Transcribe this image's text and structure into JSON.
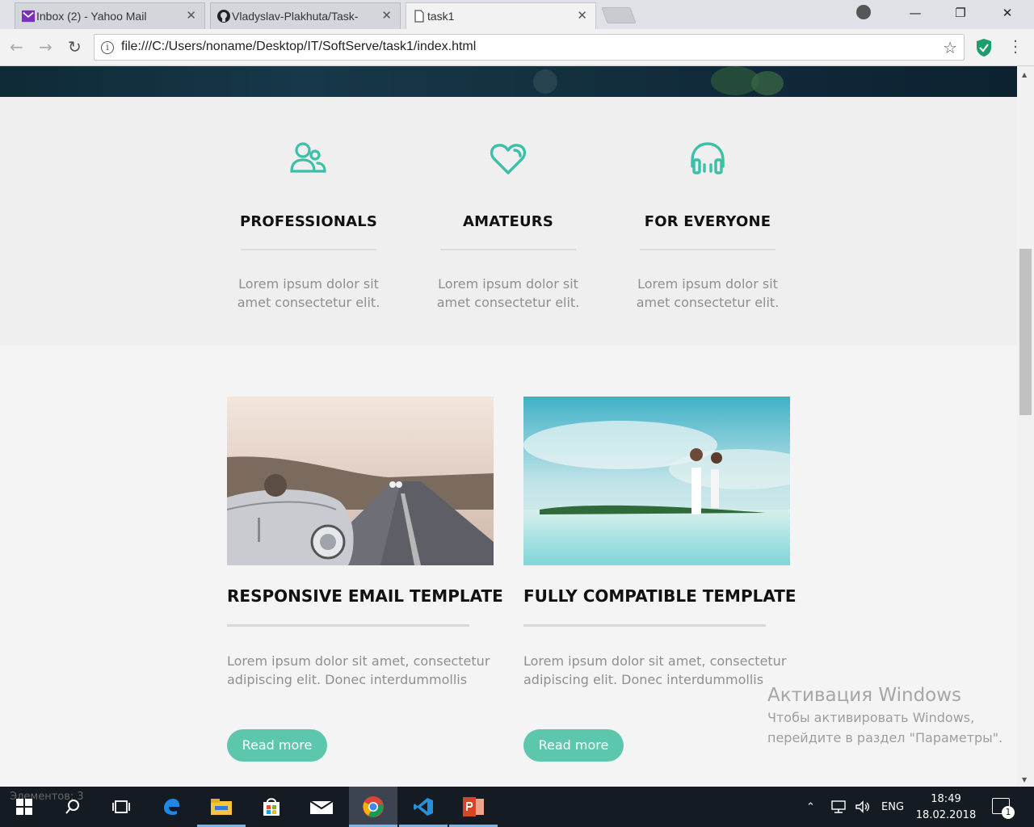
{
  "browser": {
    "tabs": [
      {
        "label": "Inbox (2) - Yahoo Mail",
        "icon": "yahoo-mail-icon"
      },
      {
        "label": "Vladyslav-Plakhuta/Task-",
        "icon": "github-icon"
      },
      {
        "label": "task1",
        "icon": "document-icon"
      }
    ],
    "url": "file:///C:/Users/noname/Desktop/IT/SoftServe/task1/index.html",
    "accent": "#5dc7ae"
  },
  "features": [
    {
      "icon": "users-icon",
      "title": "PROFESSIONALS",
      "text": "Lorem ipsum dolor sit amet consectetur elit."
    },
    {
      "icon": "heart-icon",
      "title": "AMATEURS",
      "text": "Lorem ipsum dolor sit amet consectetur elit."
    },
    {
      "icon": "headphones-icon",
      "title": "FOR EVERYONE",
      "text": "Lorem ipsum dolor sit amet consectetur elit."
    }
  ],
  "cards": [
    {
      "title": "RESPONSIVE EMAIL TEMPLATE",
      "text": "Lorem ipsum dolor sit amet, consectetur adipiscing elit. Donec interdummollis",
      "button": "Read more",
      "image": "vintage-car-photo"
    },
    {
      "title": "FULLY COMPATIBLE TEMPLATE",
      "text": "Lorem ipsum dolor sit amet, consectetur adipiscing elit. Donec interdummollis",
      "button": "Read more",
      "image": "beach-couple-photo"
    }
  ],
  "watermark": {
    "heading": "Активация Windows",
    "line1": "Чтобы активировать Windows,",
    "line2": "перейдите в раздел \"Параметры\"."
  },
  "taskbar": {
    "overlay_text": "Элементов: 3",
    "language": "ENG",
    "time": "18:49",
    "date": "18.02.2018",
    "notifications": "1"
  }
}
